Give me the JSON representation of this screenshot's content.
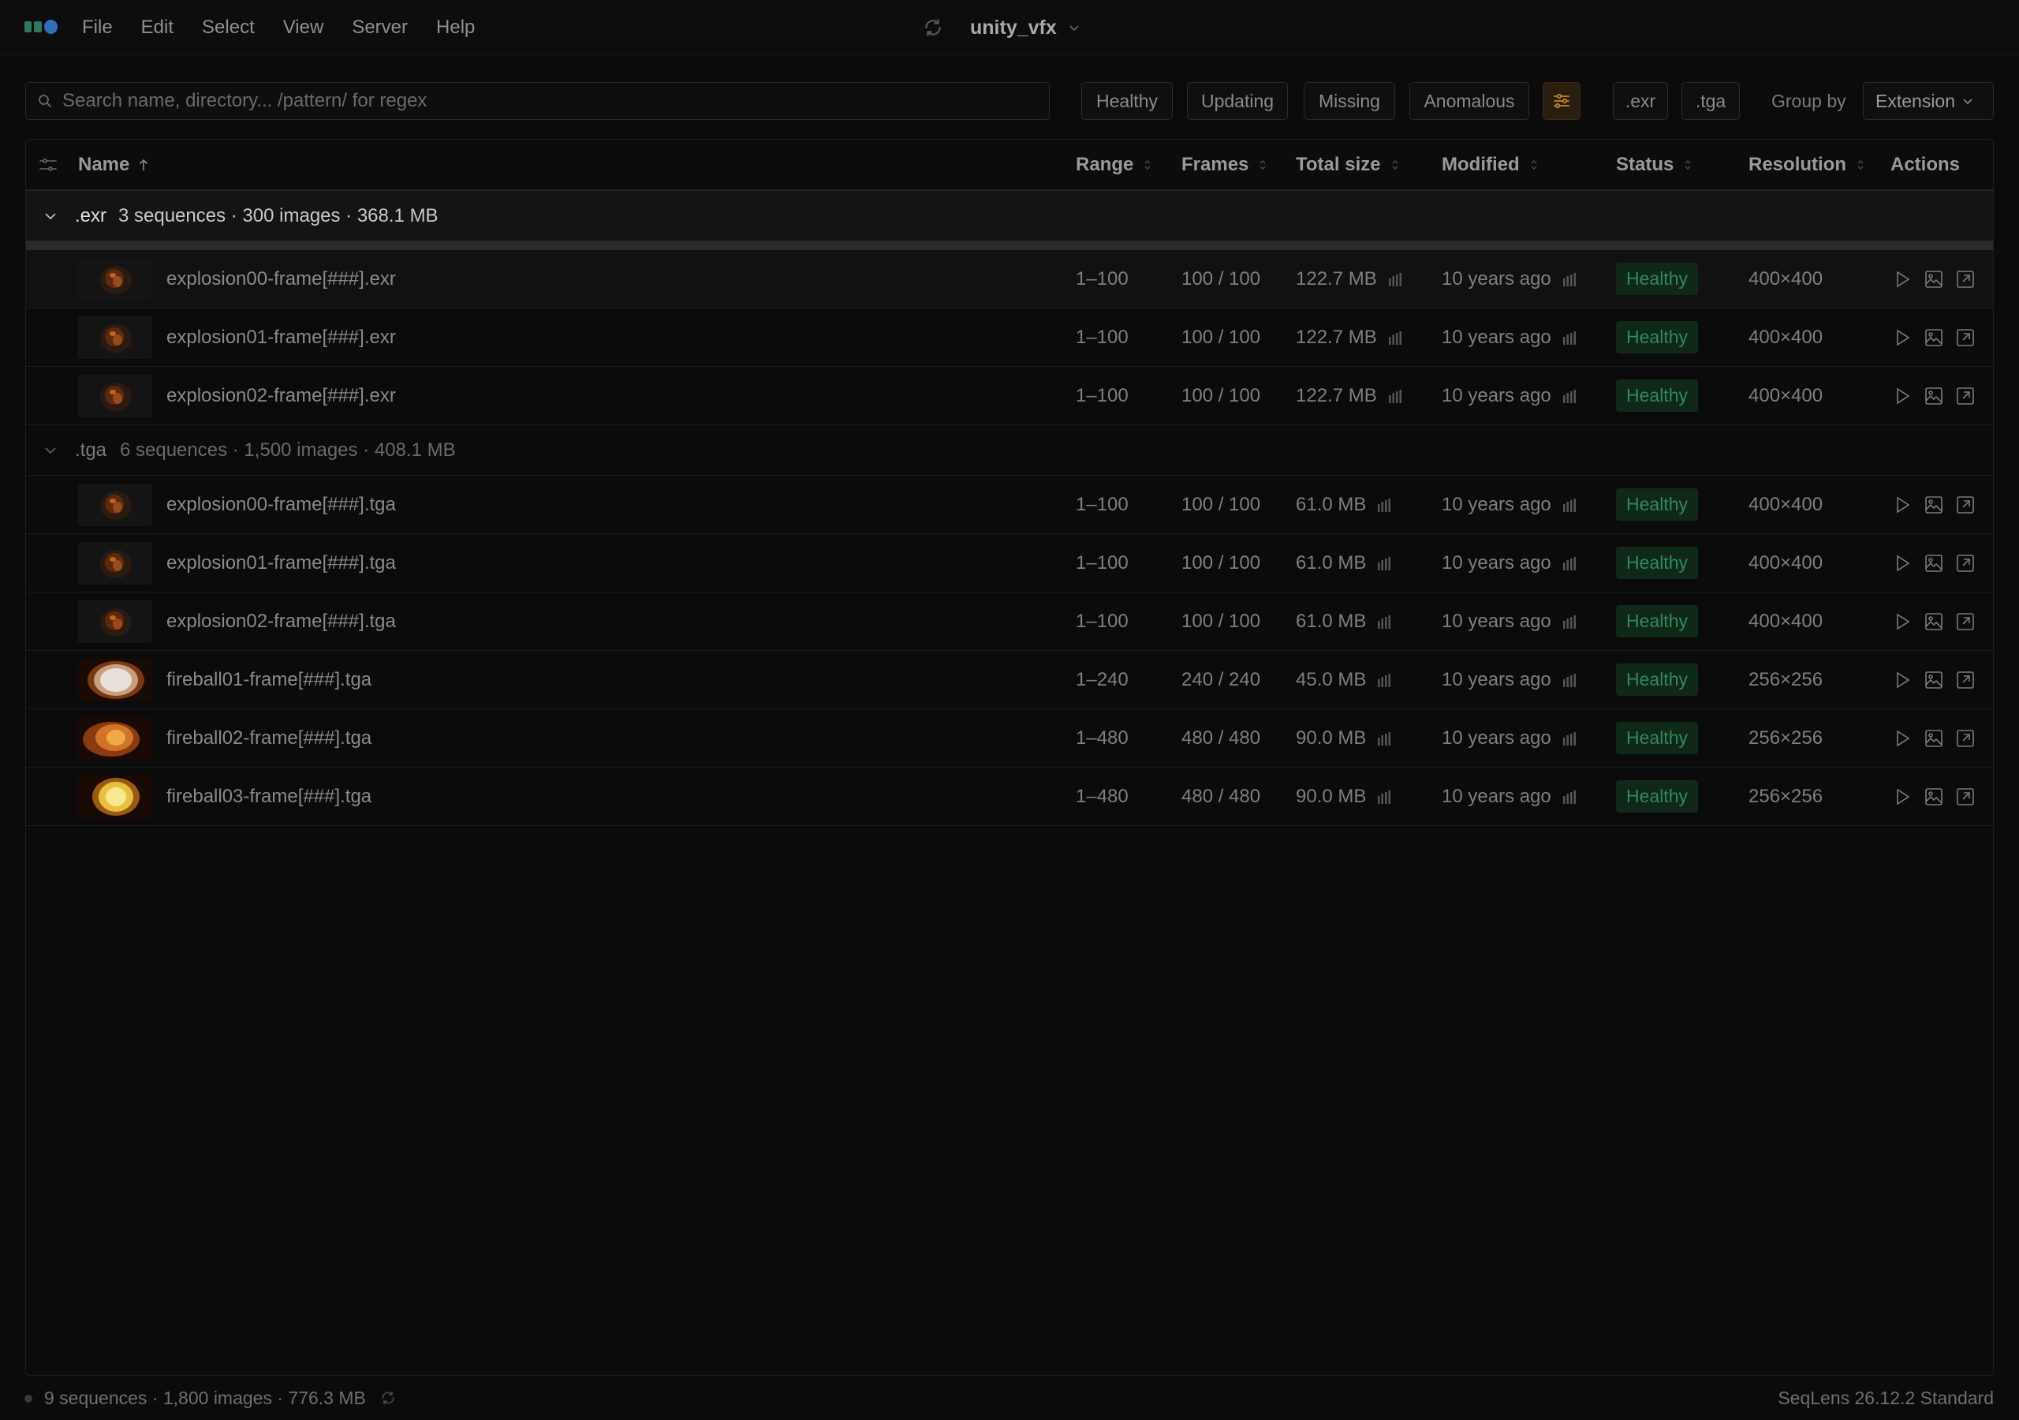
{
  "menubar": {
    "logo": "seqlens-logo",
    "items": [
      "File",
      "Edit",
      "Select",
      "View",
      "Server",
      "Help"
    ],
    "project_title": "unity_vfx"
  },
  "filters": {
    "search_placeholder": "Search name, directory... /pattern/ for regex",
    "status_chips": [
      "Healthy",
      "Updating",
      "Missing",
      "Anomalous"
    ],
    "extension_chips": [
      ".exr",
      ".tga"
    ],
    "group_by_label": "Group by",
    "group_by_value": "Extension"
  },
  "table": {
    "columns": {
      "name": "Name",
      "range": "Range",
      "frames": "Frames",
      "total_size": "Total size",
      "modified": "Modified",
      "status": "Status",
      "resolution": "Resolution",
      "actions": "Actions"
    },
    "groups": [
      {
        "name": ".exr",
        "meta": "3 sequences · 300 images · 368.1 MB",
        "rows": [
          {
            "name": "explosion00-frame[###].exr",
            "range": "1–100",
            "frames": "100 / 100",
            "size": "122.7 MB",
            "modified": "10 years ago",
            "status": "Healthy",
            "resolution": "400×400",
            "thumb": "explosion"
          },
          {
            "name": "explosion01-frame[###].exr",
            "range": "1–100",
            "frames": "100 / 100",
            "size": "122.7 MB",
            "modified": "10 years ago",
            "status": "Healthy",
            "resolution": "400×400",
            "thumb": "explosion"
          },
          {
            "name": "explosion02-frame[###].exr",
            "range": "1–100",
            "frames": "100 / 100",
            "size": "122.7 MB",
            "modified": "10 years ago",
            "status": "Healthy",
            "resolution": "400×400",
            "thumb": "explosion"
          }
        ]
      },
      {
        "name": ".tga",
        "meta": "6 sequences · 1,500 images · 408.1 MB",
        "rows": [
          {
            "name": "explosion00-frame[###].tga",
            "range": "1–100",
            "frames": "100 / 100",
            "size": "61.0 MB",
            "modified": "10 years ago",
            "status": "Healthy",
            "resolution": "400×400",
            "thumb": "explosion"
          },
          {
            "name": "explosion01-frame[###].tga",
            "range": "1–100",
            "frames": "100 / 100",
            "size": "61.0 MB",
            "modified": "10 years ago",
            "status": "Healthy",
            "resolution": "400×400",
            "thumb": "explosion"
          },
          {
            "name": "explosion02-frame[###].tga",
            "range": "1–100",
            "frames": "100 / 100",
            "size": "61.0 MB",
            "modified": "10 years ago",
            "status": "Healthy",
            "resolution": "400×400",
            "thumb": "explosion"
          },
          {
            "name": "fireball01-frame[###].tga",
            "range": "1–240",
            "frames": "240 / 240",
            "size": "45.0 MB",
            "modified": "10 years ago",
            "status": "Healthy",
            "resolution": "256×256",
            "thumb": "fireball-white"
          },
          {
            "name": "fireball02-frame[###].tga",
            "range": "1–480",
            "frames": "480 / 480",
            "size": "90.0 MB",
            "modified": "10 years ago",
            "status": "Healthy",
            "resolution": "256×256",
            "thumb": "fireball-orange"
          },
          {
            "name": "fireball03-frame[###].tga",
            "range": "1–480",
            "frames": "480 / 480",
            "size": "90.0 MB",
            "modified": "10 years ago",
            "status": "Healthy",
            "resolution": "256×256",
            "thumb": "fireball-yellow"
          }
        ]
      }
    ]
  },
  "footer": {
    "summary": "9 sequences · 1,800 images · 776.3 MB",
    "version": "SeqLens 26.12.2 Standard"
  },
  "colors": {
    "background": "#0b0b0b",
    "healthy_text": "#2f8a5a",
    "healthy_bg": "#102818",
    "accent_orange": "#c8842a"
  }
}
